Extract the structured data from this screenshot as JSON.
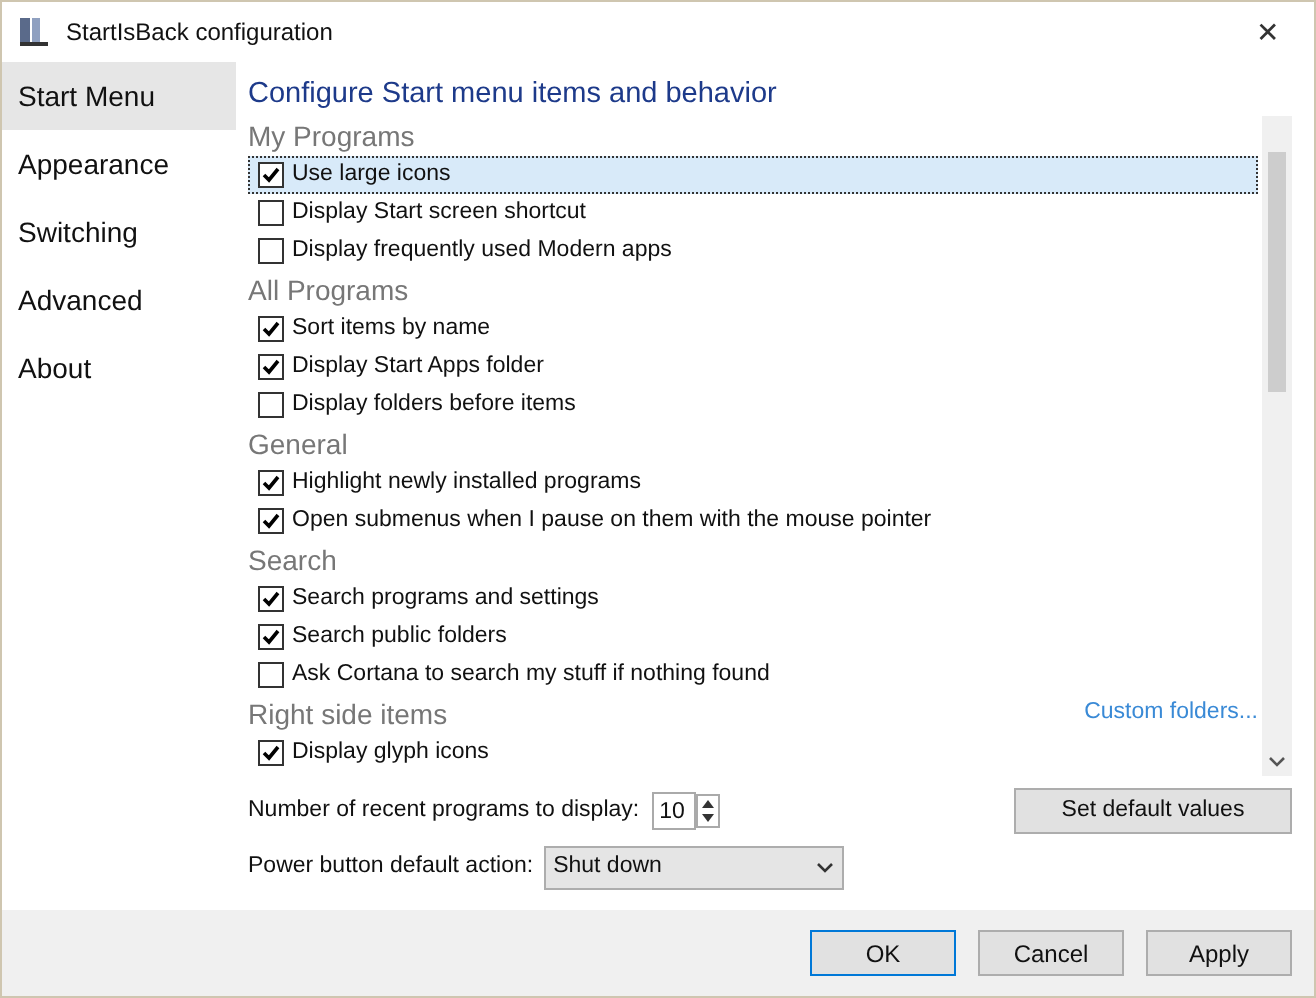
{
  "window": {
    "title": "StartIsBack configuration",
    "close": "✕"
  },
  "sidebar": {
    "items": [
      {
        "label": "Start Menu",
        "selected": true
      },
      {
        "label": "Appearance",
        "selected": false
      },
      {
        "label": "Switching",
        "selected": false
      },
      {
        "label": "Advanced",
        "selected": false
      },
      {
        "label": "About",
        "selected": false
      }
    ]
  },
  "heading": "Configure Start menu items and behavior",
  "groups": [
    {
      "title": "My Programs",
      "items": [
        {
          "label": "Use large icons",
          "checked": true,
          "selected": true
        },
        {
          "label": "Display Start screen shortcut",
          "checked": false,
          "selected": false
        },
        {
          "label": "Display frequently used Modern apps",
          "checked": false,
          "selected": false
        }
      ]
    },
    {
      "title": "All Programs",
      "items": [
        {
          "label": "Sort items by name",
          "checked": true,
          "selected": false
        },
        {
          "label": "Display Start Apps folder",
          "checked": true,
          "selected": false
        },
        {
          "label": "Display folders before items",
          "checked": false,
          "selected": false
        }
      ]
    },
    {
      "title": "General",
      "items": [
        {
          "label": "Highlight newly installed programs",
          "checked": true,
          "selected": false
        },
        {
          "label": "Open submenus when I pause on them with the mouse pointer",
          "checked": true,
          "selected": false
        }
      ]
    },
    {
      "title": "Search",
      "items": [
        {
          "label": "Search programs and settings",
          "checked": true,
          "selected": false
        },
        {
          "label": "Search public folders",
          "checked": true,
          "selected": false
        },
        {
          "label": "Ask Cortana to search my stuff if nothing found",
          "checked": false,
          "selected": false
        }
      ]
    },
    {
      "title": "Right side items",
      "link": "Custom folders...",
      "items": [
        {
          "label": "Display glyph icons",
          "checked": true,
          "selected": false
        }
      ]
    }
  ],
  "recent": {
    "label": "Number of recent programs to display:",
    "value": "10"
  },
  "default_button": "Set default values",
  "power": {
    "label": "Power button default action:",
    "value": "Shut down"
  },
  "buttons": [
    "OK",
    "Cancel",
    "Apply"
  ]
}
